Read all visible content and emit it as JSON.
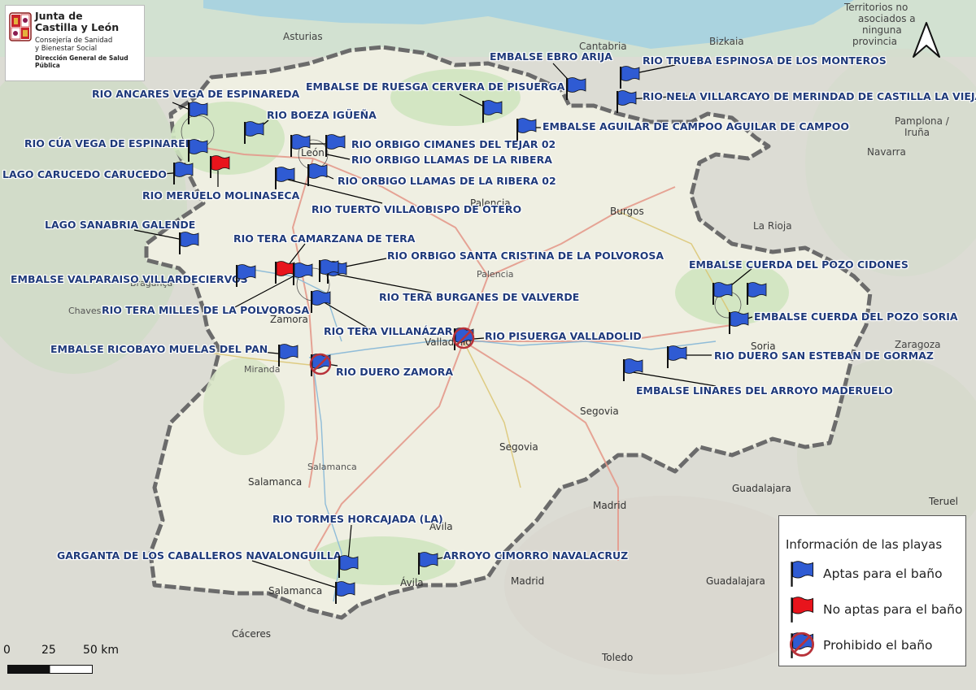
{
  "logo": {
    "title_line1": "Junta de",
    "title_line2": "Castilla y León",
    "subtitle_line1": "Consejería de Sanidad",
    "subtitle_line2": "y Bienestar Social",
    "directorate": "Dirección General de Salud Pública"
  },
  "places": [
    {
      "key": "asturias",
      "text": "Asturias"
    },
    {
      "key": "cantabria",
      "text": "Cantabria"
    },
    {
      "key": "bizkaia",
      "text": "Bizkaia"
    },
    {
      "key": "territorios1",
      "text": "Territorios no"
    },
    {
      "key": "territorios2",
      "text": "asociados a"
    },
    {
      "key": "territorios3",
      "text": "ninguna"
    },
    {
      "key": "territorios4",
      "text": "provincia"
    },
    {
      "key": "pamplona1",
      "text": "Pamplona /"
    },
    {
      "key": "pamplona2",
      "text": "Iruña"
    },
    {
      "key": "navarra",
      "text": "Navarra"
    },
    {
      "key": "larioja",
      "text": "La Rioja"
    },
    {
      "key": "zaragoza",
      "text": "Zaragoza"
    },
    {
      "key": "leon",
      "text": "León"
    },
    {
      "key": "palencia",
      "text": "Palencia"
    },
    {
      "key": "palencia2",
      "text": "Palencia"
    },
    {
      "key": "burgos",
      "text": "Burgos"
    },
    {
      "key": "zamora",
      "text": "Zamora"
    },
    {
      "key": "valladolid",
      "text": "Valladolid"
    },
    {
      "key": "soria",
      "text": "Soria"
    },
    {
      "key": "segovia1",
      "text": "Segovia"
    },
    {
      "key": "segovia2",
      "text": "Segovia"
    },
    {
      "key": "salamanca1",
      "text": "Salamanca"
    },
    {
      "key": "salamanca2",
      "text": "Salamanca"
    },
    {
      "key": "avila1",
      "text": "Ávila"
    },
    {
      "key": "avila2",
      "text": "Ávila"
    },
    {
      "key": "madrid1",
      "text": "Madrid"
    },
    {
      "key": "madrid2",
      "text": "Madrid"
    },
    {
      "key": "guadalajara1",
      "text": "Guadalajara"
    },
    {
      "key": "guadalajara2",
      "text": "Guadalajara"
    },
    {
      "key": "teruel",
      "text": "Teruel"
    },
    {
      "key": "caceres",
      "text": "Cáceres"
    },
    {
      "key": "toledo",
      "text": "Toledo"
    },
    {
      "key": "chaves",
      "text": "Chaves"
    },
    {
      "key": "braganca",
      "text": "Bragança"
    },
    {
      "key": "miranda",
      "text": "Miranda"
    },
    {
      "key": "salamanca_road",
      "text": "Salamanca"
    }
  ],
  "beaches": [
    {
      "name": "RIO ANCARES VEGA DE ESPINAREDA",
      "status": "apta"
    },
    {
      "name": "RIO BOEZA IGÜEÑA",
      "status": "apta"
    },
    {
      "name": "RIO CÚA VEGA DE ESPINAREDA",
      "status": "apta"
    },
    {
      "name": "LAGO CARUCEDO CARUCEDO",
      "status": "apta"
    },
    {
      "name": "RIO MERUELO MOLINASECA",
      "status": "no_apta"
    },
    {
      "name": "EMBALSE DE RUESGA CERVERA DE PISUERGA",
      "status": "apta"
    },
    {
      "name": "RIO ORBIGO CIMANES DEL TEJAR 02",
      "status": "apta"
    },
    {
      "name": "RIO ORBIGO LLAMAS DE LA RIBERA",
      "status": "apta"
    },
    {
      "name": "RIO ORBIGO LLAMAS DE LA RIBERA 02",
      "status": "apta"
    },
    {
      "name": "RIO TUERTO VILLAOBISPO DE OTERO",
      "status": "apta"
    },
    {
      "name": "EMBALSE EBRO ARIJA",
      "status": "apta"
    },
    {
      "name": "RIO TRUEBA ESPINOSA DE LOS MONTEROS",
      "status": "apta"
    },
    {
      "name": "RIO NELA VILLARCAYO DE MERINDAD DE CASTILLA LA VIEJA",
      "status": "apta"
    },
    {
      "name": "EMBALSE AGUILAR DE CAMPOO AGUILAR DE CAMPOO",
      "status": "apta"
    },
    {
      "name": "LAGO SANABRIA GALENDE",
      "status": "apta"
    },
    {
      "name": "RIO TERA CAMARZANA DE TERA",
      "status": "no_apta"
    },
    {
      "name": "RIO ORBIGO SANTA CRISTINA DE LA POLVOROSA",
      "status": "apta"
    },
    {
      "name": "EMBALSE VALPARAISO VILLARDECIERVOS",
      "status": "apta"
    },
    {
      "name": "RIO TERA MILLES DE LA POLVOROSA",
      "status": "apta"
    },
    {
      "name": "RIO TERA BURGANES DE VALVERDE",
      "status": "apta"
    },
    {
      "name": "RIO TERA VILLANÁZAR",
      "status": "apta"
    },
    {
      "name": "RIO PISUERGA VALLADOLID",
      "status": "prohibido"
    },
    {
      "name": "EMBALSE RICOBAYO MUELAS DEL PAN",
      "status": "apta"
    },
    {
      "name": "RIO DUERO ZAMORA",
      "status": "prohibido"
    },
    {
      "name": "EMBALSE CUERDA DEL POZO CIDONES",
      "status": "apta"
    },
    {
      "name": "EMBALSE CUERDA DEL POZO SORIA",
      "status": "apta"
    },
    {
      "name": "RIO DUERO SAN ESTEBAN DE GORMAZ",
      "status": "apta"
    },
    {
      "name": "EMBALSE LINARES DEL ARROYO MADERUELO",
      "status": "apta"
    },
    {
      "name": "RIO TORMES HORCAJADA (LA)",
      "status": "apta"
    },
    {
      "name": "GARGANTA DE LOS CABALLEROS NAVALONGUILLA",
      "status": "apta"
    },
    {
      "name": "ARROYO CIMORRO NAVALACRUZ",
      "status": "apta"
    }
  ],
  "legend": {
    "title": "Información de las playas",
    "items": [
      {
        "label": "Aptas para el baño",
        "status": "apta"
      },
      {
        "label": "No aptas para el baño",
        "status": "no_apta"
      },
      {
        "label": "Prohibido el baño",
        "status": "prohibido"
      }
    ]
  },
  "scale_bar": {
    "labels": [
      "0",
      "25",
      "50 km"
    ]
  },
  "north_arrow": {
    "icon": "north-arrow-icon"
  },
  "colors": {
    "flag_apta": "#2f5bd3",
    "flag_no_apta": "#e8141c",
    "prohibido_ring": "#b8323a",
    "label_text": "#1f3a7a",
    "region_fill": "#eeeee0",
    "outside_fill": "#ddddd6",
    "boundary": "#6b6b6b"
  }
}
